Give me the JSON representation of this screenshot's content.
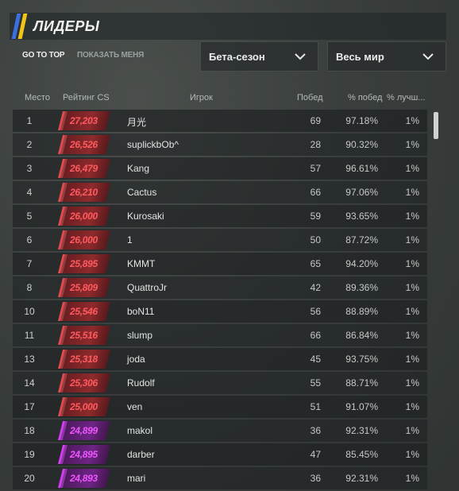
{
  "header": {
    "title": "ЛИДЕРЫ"
  },
  "subnav": {
    "go_to_top": "GO TO TOP",
    "show_me": "ПОКАЗАТЬ МЕНЯ"
  },
  "filters": {
    "season": "Бета-сезон",
    "region": "Весь мир"
  },
  "columns": {
    "rank": "Место",
    "rating": "Рейтинг CS",
    "player": "Игрок",
    "wins": "Побед",
    "win_pct": "% побед",
    "best": "% лучш..."
  },
  "colors": {
    "red_tier": "#ff5a5e",
    "purple_tier": "#ee56ff",
    "flag_blue": "#3c6fe0",
    "flag_yellow": "#f2c418"
  },
  "rows": [
    {
      "rank": "1",
      "rating": "27,203",
      "tier": "red",
      "name": "月光",
      "wins": "69",
      "pct": "97.18%",
      "best": "1%"
    },
    {
      "rank": "2",
      "rating": "26,526",
      "tier": "red",
      "name": "suplickbOb^",
      "wins": "28",
      "pct": "90.32%",
      "best": "1%"
    },
    {
      "rank": "3",
      "rating": "26,479",
      "tier": "red",
      "name": "Kang",
      "wins": "57",
      "pct": "96.61%",
      "best": "1%"
    },
    {
      "rank": "4",
      "rating": "26,210",
      "tier": "red",
      "name": "Cactus",
      "wins": "66",
      "pct": "97.06%",
      "best": "1%"
    },
    {
      "rank": "5",
      "rating": "26,000",
      "tier": "red",
      "name": "Kurosaki",
      "wins": "59",
      "pct": "93.65%",
      "best": "1%"
    },
    {
      "rank": "6",
      "rating": "26,000",
      "tier": "red",
      "name": "1",
      "wins": "50",
      "pct": "87.72%",
      "best": "1%"
    },
    {
      "rank": "7",
      "rating": "25,895",
      "tier": "red",
      "name": "KMMT",
      "wins": "65",
      "pct": "94.20%",
      "best": "1%"
    },
    {
      "rank": "8",
      "rating": "25,809",
      "tier": "red",
      "name": "QuattroJr",
      "wins": "42",
      "pct": "89.36%",
      "best": "1%"
    },
    {
      "rank": "10",
      "rating": "25,546",
      "tier": "red",
      "name": "boN11",
      "wins": "56",
      "pct": "88.89%",
      "best": "1%"
    },
    {
      "rank": "11",
      "rating": "25,516",
      "tier": "red",
      "name": "slump",
      "wins": "66",
      "pct": "86.84%",
      "best": "1%"
    },
    {
      "rank": "13",
      "rating": "25,318",
      "tier": "red",
      "name": "joda",
      "wins": "45",
      "pct": "93.75%",
      "best": "1%"
    },
    {
      "rank": "14",
      "rating": "25,306",
      "tier": "red",
      "name": "Rudolf",
      "wins": "55",
      "pct": "88.71%",
      "best": "1%"
    },
    {
      "rank": "17",
      "rating": "25,000",
      "tier": "red",
      "name": "ven",
      "wins": "51",
      "pct": "91.07%",
      "best": "1%"
    },
    {
      "rank": "18",
      "rating": "24,899",
      "tier": "purple",
      "name": "makol",
      "wins": "36",
      "pct": "92.31%",
      "best": "1%"
    },
    {
      "rank": "19",
      "rating": "24,895",
      "tier": "purple",
      "name": "darber",
      "wins": "47",
      "pct": "85.45%",
      "best": "1%"
    },
    {
      "rank": "20",
      "rating": "24,893",
      "tier": "purple",
      "name": "mari",
      "wins": "36",
      "pct": "92.31%",
      "best": "1%"
    }
  ]
}
